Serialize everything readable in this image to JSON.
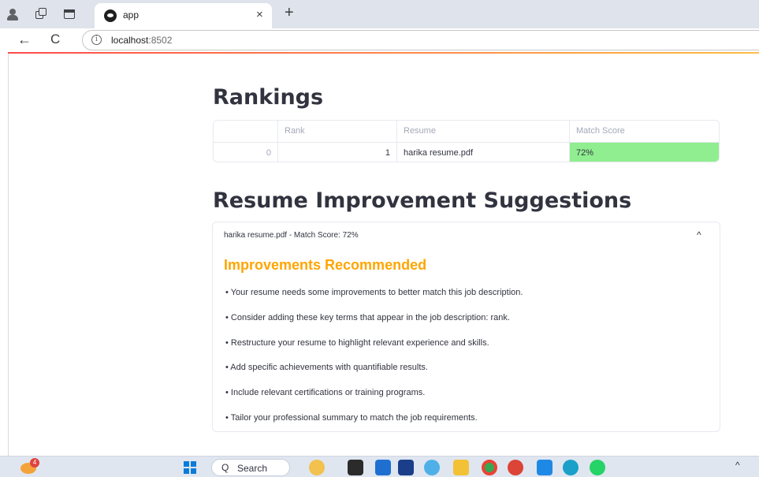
{
  "browser": {
    "tab_title": "app",
    "tab_close": "×",
    "new_tab": "+",
    "back": "←",
    "reload": "C",
    "url_host": "localhost",
    "url_port": ":8502",
    "info": "i"
  },
  "rankings": {
    "heading": "Rankings",
    "columns": [
      "",
      "Rank",
      "Resume",
      "Match Score"
    ],
    "rows": [
      {
        "index": "0",
        "rank": "1",
        "resume": "harika resume.pdf",
        "score": "72%"
      }
    ],
    "score_highlight": "#90ee90"
  },
  "suggestions": {
    "heading": "Resume Improvement Suggestions",
    "expander_label": "harika resume.pdf - Match Score: 72%",
    "chevron": "^",
    "title": "Improvements Recommended",
    "title_color": "#ffa500",
    "items": [
      "• Your resume needs some improvements to better match this job description.",
      "• Consider adding these key terms that appear in the job description: rank.",
      "• Restructure your resume to highlight relevant experience and skills.",
      "• Add specific achievements with quantifiable results.",
      "• Include relevant certifications or training programs.",
      "• Tailor your professional summary to match the job requirements."
    ]
  },
  "taskbar": {
    "widget_badge": "4",
    "search_label": "Search",
    "search_icon": "Q",
    "apps": [
      "weather-icon",
      "explorer-icon",
      "store-icon",
      "dropbox-icon",
      "photos-icon",
      "files-icon",
      "chrome-icon",
      "chrome-profile-icon",
      "vscode-icon",
      "edge-icon",
      "whatsapp-icon"
    ],
    "tray_arrow": "^"
  }
}
